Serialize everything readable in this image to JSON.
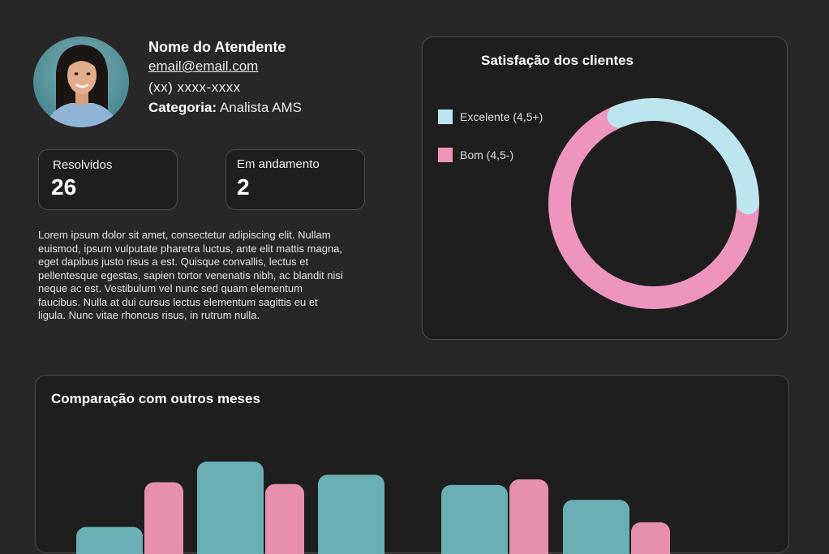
{
  "profile": {
    "name": "Nome do Atendente",
    "email": "email@email.com",
    "phone": "(xx) xxxx-xxxx",
    "category_label": "Categoria:",
    "category_value": " Analista AMS"
  },
  "stats": {
    "resolved": {
      "label": "Resolvidos",
      "value": "26"
    },
    "in_progress": {
      "label": "Em andamento",
      "value": "2"
    }
  },
  "description": "Lorem ipsum dolor sit amet, consectetur adipiscing elit. Nullam euismod, ipsum vulputate pharetra luctus, ante elit mattis magna, eget dapibus justo risus a est. Quisque convallis, lectus et pellentesque egestas, sapien tortor venenatis nibh, ac blandit nisi neque ac est. Vestibulum vel nunc sed quam elementum faucibus. Nulla at dui cursus lectus elementum sagittis eu et ligula. Nunc vitae rhoncus risus, in rutrum nulla.",
  "satisfaction": {
    "title": "Satisfação dos clientes",
    "colors": {
      "excellent": "#bde5ef",
      "good": "#ee95bd"
    },
    "chart_data": {
      "type": "pie",
      "title": "Satisfação dos clientes",
      "legend": "left",
      "series": [
        {
          "name": "Excelente (4,5+)",
          "value": 31
        },
        {
          "name": "Bom (4,5-)",
          "value": 69
        }
      ]
    }
  },
  "comparison": {
    "title": "Comparação com outros meses",
    "colors": {
      "a": "#6aafb4",
      "b": "#e690ab"
    },
    "chart_data": {
      "type": "bar",
      "title": "Comparação com outros meses",
      "visible_bars": [
        {
          "series": "a",
          "value": 29
        },
        {
          "series": "b",
          "value": 77
        },
        {
          "series": "a",
          "value": 99
        },
        {
          "series": "b",
          "value": 75
        },
        {
          "series": "a",
          "value": 85
        },
        {
          "series": "a",
          "value": 74
        },
        {
          "series": "b",
          "value": 80
        },
        {
          "series": "a",
          "value": 58
        },
        {
          "series": "b",
          "value": 34
        }
      ]
    }
  }
}
